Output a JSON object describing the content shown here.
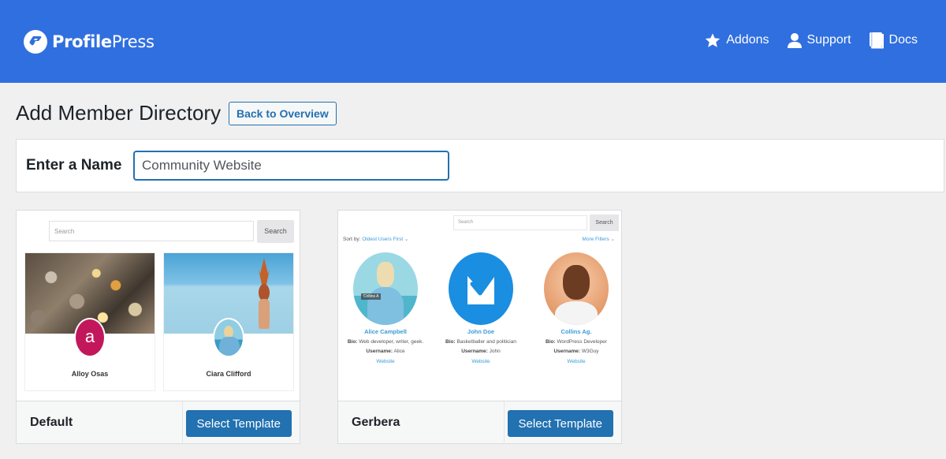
{
  "header": {
    "brand_bold": "Profile",
    "brand_light": "Press",
    "nav": [
      {
        "label": "Addons",
        "icon": "star-icon"
      },
      {
        "label": "Support",
        "icon": "user-icon"
      },
      {
        "label": "Docs",
        "icon": "book-icon"
      }
    ],
    "colors": {
      "bar": "#306fdf"
    }
  },
  "page": {
    "title": "Add Member Directory",
    "back_button": "Back to Overview"
  },
  "name_form": {
    "label": "Enter a Name",
    "value": "Community Website"
  },
  "templates": [
    {
      "name": "Default",
      "button": "Select Template",
      "preview": {
        "search_placeholder": "Search",
        "search_button": "Search",
        "members": [
          {
            "name": "Alloy Osas",
            "avatar_letter": "a",
            "cover": "coins"
          },
          {
            "name": "Ciara Clifford",
            "cover": "sea"
          }
        ]
      }
    },
    {
      "name": "Gerbera",
      "button": "Select Template",
      "preview": {
        "search_placeholder": "Search",
        "search_button": "Search",
        "sort_label": "Sort by:",
        "sort_value": "Oldest Users First",
        "more_filters": "More Filters",
        "members": [
          {
            "name": "Alice Campbell",
            "bio_label": "Bio:",
            "bio": "Web developer, writer, geek.",
            "username_label": "Username:",
            "username": "Alice",
            "link": "Website",
            "photo_tag": "Collins A"
          },
          {
            "name": "John Doe",
            "bio_label": "Bio:",
            "bio": "Basketballer and politician",
            "username_label": "Username:",
            "username": "John",
            "link": "Website"
          },
          {
            "name": "Collins Ag.",
            "bio_label": "Bio:",
            "bio": "WordPress Developer",
            "username_label": "Username:",
            "username": "W3Guy",
            "link": "Website"
          }
        ]
      }
    }
  ]
}
